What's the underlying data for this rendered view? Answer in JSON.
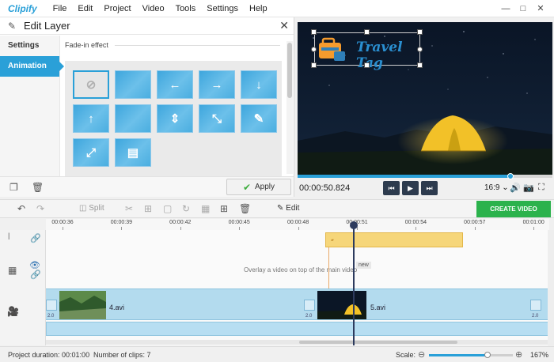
{
  "app": {
    "name": "Clipify"
  },
  "menu": [
    "File",
    "Edit",
    "Project",
    "Video",
    "Tools",
    "Settings",
    "Help"
  ],
  "window_controls": [
    "minimize-icon",
    "maximize-icon",
    "close-icon"
  ],
  "edit_layer": {
    "title": "Edit Layer",
    "tabs": [
      {
        "label": "Settings",
        "active": false
      },
      {
        "label": "Animation",
        "active": true
      }
    ],
    "section_label": "Fade-in effect",
    "effects": [
      {
        "name": "none",
        "icon": "⊘",
        "selected": true
      },
      {
        "name": "fade-gradient",
        "icon": "",
        "selected": false
      },
      {
        "name": "slide-left",
        "icon": "←",
        "selected": false
      },
      {
        "name": "slide-right",
        "icon": "→",
        "selected": false
      },
      {
        "name": "slide-down",
        "icon": "↓",
        "selected": false
      },
      {
        "name": "slide-up",
        "icon": "↑",
        "selected": false
      },
      {
        "name": "fade-gradient-2",
        "icon": "",
        "selected": false
      },
      {
        "name": "expand-vertical",
        "icon": "⇕",
        "selected": false
      },
      {
        "name": "collapse-center",
        "icon": "⤡",
        "selected": false
      },
      {
        "name": "draw-pen",
        "icon": "✎",
        "selected": false
      },
      {
        "name": "expand-corners",
        "icon": "⤢",
        "selected": false
      },
      {
        "name": "assemble",
        "icon": "▤",
        "selected": false
      }
    ],
    "apply_label": "Apply",
    "accent": "#2aa0d8"
  },
  "preview": {
    "timecode": "00:00:50.824",
    "aspect": "16:9",
    "logo_text": "Travel Tag",
    "progress": 0.83
  },
  "toolbar": {
    "split_label": "Split",
    "edit_label": "Edit",
    "create_label": "CREATE VIDEO",
    "create_color": "#2bb24c"
  },
  "timeline": {
    "ticks": [
      "00:00:36",
      "00:00:39",
      "00:00:42",
      "00:00:45",
      "00:00:48",
      "00:00:51",
      "00:00:54",
      "00:00:57",
      "00:01:00"
    ],
    "overlay_hint": "Overlay a video on top of the main video",
    "new_badge": "new",
    "clips": [
      {
        "label": "4.avi"
      },
      {
        "label": "5.avi"
      }
    ],
    "transition_value": "2.0"
  },
  "status": {
    "duration": "Project duration:  00:01:00",
    "clips": "Number of clips: 7",
    "scale_label": "Scale:",
    "scale_value": "167%",
    "scale_level": 0.7
  }
}
